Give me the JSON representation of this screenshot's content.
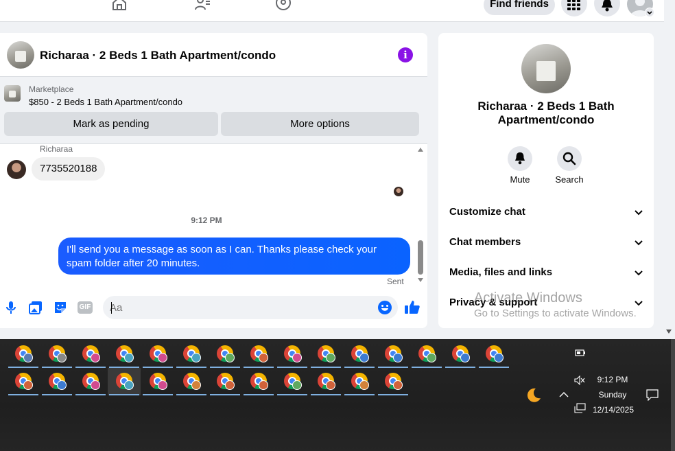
{
  "topbar": {
    "icons": [
      "home-icon",
      "friends-icon",
      "groups-icon"
    ],
    "find_friends": "Find friends",
    "menu_icon": "grid-menu-icon",
    "notifications_icon": "bell-icon"
  },
  "chat": {
    "title": "Richaraa · 2 Beds 1 Bath Apartment/condo",
    "info_icon_text": "i",
    "marketplace": {
      "label": "Marketplace",
      "price_line": "$850 - 2 Beds 1 Bath Apartment/condo",
      "mark_pending": "Mark as pending",
      "more_options": "More options"
    },
    "messages": {
      "sender_name": "Richaraa",
      "incoming_text": "7735520188",
      "timestamp": "9:12 PM",
      "outgoing_text": "I'll send you a message as soon as I can. Thanks please check your spam folder after 20 minutes.",
      "status": "Sent"
    },
    "composer": {
      "placeholder": "Aa",
      "icons": [
        "microphone-icon",
        "gallery-icon",
        "sticker-icon",
        "gif-icon",
        "emoji-icon",
        "thumbs-up-icon"
      ],
      "gif_label": "GIF"
    }
  },
  "info_panel": {
    "title": "Richaraa · 2 Beds 1 Bath Apartment/condo",
    "actions": [
      {
        "label": "Mute",
        "icon": "bell-icon"
      },
      {
        "label": "Search",
        "icon": "search-icon"
      }
    ],
    "sections": [
      "Customize chat",
      "Chat members",
      "Media, files and links",
      "Privacy & support"
    ]
  },
  "watermark": {
    "line1": "Activate Windows",
    "line2": "Go to Settings to activate Windows."
  },
  "taskbar": {
    "row1_badges": [
      "#5a7ab0",
      "#888888",
      "#d14b8f",
      "#4aa3c0",
      "#d14b8f",
      "#4aa3c0",
      "#5fa860",
      "#d1623a",
      "#d14b8f",
      "#5fa860",
      "#3d7bd1",
      "#3d7bd1",
      "#5fa860",
      "#3d7bd1",
      "#3d7bd1"
    ],
    "row2_badges": [
      "#d1623a",
      "#3d7bd1",
      "#d14b8f",
      "#4aa3c0",
      "#d14b8f",
      "#d1823a",
      "#d1623a",
      "#d1623a",
      "#5fa860",
      "#d1623a",
      "#d1823a",
      "#d1623a"
    ],
    "time": "9:12 PM",
    "day": "Sunday",
    "date": "12/14/2025",
    "tray_icons": [
      "battery-icon",
      "muted-speaker-icon",
      "network-icon",
      "chevron-up-icon",
      "moon-icon",
      "notification-icon"
    ]
  }
}
